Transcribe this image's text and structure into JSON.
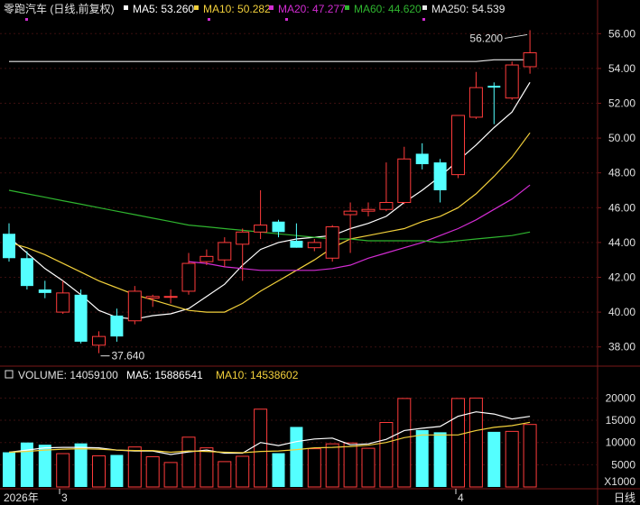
{
  "stock_name": "零跑汽车 (日线,前复权)",
  "colors": {
    "up": "#ff3b3b",
    "down": "#54ffff",
    "ma5": "#ffffff",
    "ma10": "#f2d03b",
    "ma20": "#d22cd2",
    "ma60": "#2fb52f",
    "ma250": "#e8e8e8",
    "axis_text": "#e0e0e0",
    "grid": "#3a0f0f",
    "border": "#7a1818"
  },
  "price_legend": [
    {
      "label": "MA5: 53.260",
      "color": "#ffffff"
    },
    {
      "label": "MA10: 50.282",
      "color": "#f2d03b"
    },
    {
      "label": "MA20: 47.277",
      "color": "#d22cd2"
    },
    {
      "label": "MA60: 44.620",
      "color": "#2fb52f"
    },
    {
      "label": "MA250: 54.539",
      "color": "#e8e8e8"
    }
  ],
  "volume_legend": [
    {
      "label": "VOLUME: 14059100",
      "color": "#e0e0e0"
    },
    {
      "label": "MA5: 15886541",
      "color": "#ffffff"
    },
    {
      "label": "MA10: 14538602",
      "color": "#f2d03b"
    }
  ],
  "x_labels": {
    "year": "2026年",
    "march": "3",
    "april": "4",
    "period": "日线"
  },
  "volume_unit": "X1000",
  "chart_data": [
    {
      "type": "candlestick",
      "title": "零跑汽车 (日线,前复权)",
      "y_ticks": [
        "38.00",
        "40.00",
        "42.00",
        "44.00",
        "46.00",
        "48.00",
        "50.00",
        "52.00",
        "54.00",
        "56.00"
      ],
      "ylim": [
        37.0,
        57.0
      ],
      "annotations": [
        {
          "text": "56.200",
          "candle_index": 29,
          "value": 56.2
        },
        {
          "text": "37.640",
          "candle_index": 5,
          "value": 37.64
        }
      ],
      "candles": [
        {
          "o": 44.5,
          "h": 45.1,
          "l": 42.9,
          "c": 43.1
        },
        {
          "o": 43.1,
          "h": 43.5,
          "l": 41.3,
          "c": 41.5
        },
        {
          "o": 41.3,
          "h": 41.8,
          "l": 40.8,
          "c": 41.1
        },
        {
          "o": 40.0,
          "h": 41.8,
          "l": 39.9,
          "c": 41.1
        },
        {
          "o": 41.0,
          "h": 41.3,
          "l": 38.2,
          "c": 38.3
        },
        {
          "o": 38.1,
          "h": 38.9,
          "l": 37.64,
          "c": 38.6
        },
        {
          "o": 39.8,
          "h": 40.2,
          "l": 38.3,
          "c": 38.6
        },
        {
          "o": 39.5,
          "h": 41.5,
          "l": 39.3,
          "c": 41.2
        },
        {
          "o": 40.8,
          "h": 41.0,
          "l": 40.3,
          "c": 40.9
        },
        {
          "o": 40.9,
          "h": 41.3,
          "l": 40.5,
          "c": 40.9
        },
        {
          "o": 41.2,
          "h": 43.4,
          "l": 41.0,
          "c": 42.8
        },
        {
          "o": 42.9,
          "h": 43.6,
          "l": 42.7,
          "c": 43.2
        },
        {
          "o": 43.0,
          "h": 44.3,
          "l": 42.6,
          "c": 44.0
        },
        {
          "o": 43.9,
          "h": 44.8,
          "l": 41.8,
          "c": 44.6
        },
        {
          "o": 44.6,
          "h": 47.0,
          "l": 44.2,
          "c": 45.0
        },
        {
          "o": 45.2,
          "h": 45.3,
          "l": 44.3,
          "c": 44.6
        },
        {
          "o": 44.1,
          "h": 45.1,
          "l": 43.7,
          "c": 43.7
        },
        {
          "o": 43.7,
          "h": 44.2,
          "l": 43.5,
          "c": 44.0
        },
        {
          "o": 43.1,
          "h": 45.0,
          "l": 42.9,
          "c": 44.9
        },
        {
          "o": 45.6,
          "h": 46.3,
          "l": 43.4,
          "c": 45.8
        },
        {
          "o": 45.8,
          "h": 46.3,
          "l": 45.5,
          "c": 45.9
        },
        {
          "o": 45.9,
          "h": 48.6,
          "l": 45.8,
          "c": 46.3
        },
        {
          "o": 46.3,
          "h": 49.5,
          "l": 46.2,
          "c": 48.8
        },
        {
          "o": 49.1,
          "h": 49.7,
          "l": 48.2,
          "c": 48.5
        },
        {
          "o": 48.6,
          "h": 48.8,
          "l": 46.3,
          "c": 47.0
        },
        {
          "o": 47.9,
          "h": 51.3,
          "l": 47.7,
          "c": 51.3
        },
        {
          "o": 51.2,
          "h": 53.8,
          "l": 51.1,
          "c": 52.9
        },
        {
          "o": 53.0,
          "h": 53.2,
          "l": 50.8,
          "c": 52.9
        },
        {
          "o": 52.3,
          "h": 54.4,
          "l": 52.2,
          "c": 54.2
        },
        {
          "o": 54.1,
          "h": 56.2,
          "l": 53.7,
          "c": 54.9
        }
      ],
      "ma_lines": [
        {
          "name": "MA5",
          "color": "#ffffff",
          "values": [
            44.3,
            43.4,
            42.5,
            41.8,
            41.0,
            40.1,
            39.7,
            39.6,
            39.8,
            39.9,
            40.2,
            40.9,
            41.6,
            42.7,
            43.6,
            44.0,
            44.2,
            44.3,
            44.4,
            44.8,
            45.1,
            45.5,
            46.3,
            47.0,
            47.8,
            48.7,
            49.6,
            50.6,
            51.5,
            53.2
          ]
        },
        {
          "name": "MA10",
          "color": "#f2d03b",
          "values": [
            44.0,
            43.7,
            43.3,
            42.8,
            42.3,
            41.8,
            41.4,
            41.0,
            40.7,
            40.4,
            40.1,
            40.0,
            40.0,
            40.5,
            41.2,
            41.8,
            42.4,
            43.0,
            43.7,
            44.2,
            44.4,
            44.6,
            44.8,
            45.2,
            45.5,
            46.0,
            46.8,
            47.8,
            48.9,
            50.3
          ]
        },
        {
          "name": "MA20",
          "color": "#d22cd2",
          "values": [
            null,
            null,
            null,
            null,
            null,
            null,
            null,
            null,
            null,
            null,
            42.9,
            42.8,
            42.6,
            42.5,
            42.4,
            42.4,
            42.4,
            42.4,
            42.5,
            42.7,
            43.1,
            43.4,
            43.7,
            44.0,
            44.4,
            44.8,
            45.3,
            45.9,
            46.5,
            47.3
          ]
        },
        {
          "name": "MA60",
          "color": "#2fb52f",
          "values": [
            47.0,
            46.8,
            46.6,
            46.4,
            46.2,
            46.0,
            45.8,
            45.6,
            45.4,
            45.2,
            45.0,
            44.9,
            44.8,
            44.7,
            44.6,
            44.5,
            44.4,
            44.3,
            44.2,
            44.2,
            44.1,
            44.1,
            44.1,
            44.1,
            44.0,
            44.1,
            44.2,
            44.3,
            44.4,
            44.6
          ]
        },
        {
          "name": "MA250",
          "color": "#e8e8e8",
          "values": [
            54.4,
            54.4,
            54.4,
            54.4,
            54.4,
            54.4,
            54.4,
            54.4,
            54.4,
            54.4,
            54.4,
            54.4,
            54.4,
            54.4,
            54.4,
            54.4,
            54.4,
            54.4,
            54.4,
            54.4,
            54.4,
            54.4,
            54.4,
            54.4,
            54.4,
            54.4,
            54.4,
            54.5,
            54.5,
            54.5
          ]
        }
      ]
    },
    {
      "type": "bar",
      "title": "VOLUME",
      "y_ticks": [
        "5000",
        "10000",
        "15000",
        "20000"
      ],
      "ylim": [
        0,
        21500
      ],
      "values": [
        7800,
        10000,
        9500,
        7500,
        9800,
        7000,
        7200,
        9000,
        6800,
        5500,
        11200,
        8800,
        5700,
        6900,
        17500,
        7600,
        13500,
        8600,
        9700,
        9900,
        8700,
        14500,
        19900,
        12800,
        12300,
        19900,
        20000,
        12400,
        12500,
        14059
      ],
      "ma_lines": [
        {
          "name": "MA5",
          "color": "#ffffff",
          "values": [
            7800,
            8300,
            8800,
            8900,
            8900,
            8800,
            8300,
            8100,
            8100,
            7300,
            7900,
            8300,
            7600,
            7600,
            10000,
            9300,
            10200,
            10800,
            11000,
            9500,
            9700,
            10700,
            12700,
            13200,
            13600,
            15900,
            16900,
            16400,
            15300,
            15886
          ]
        },
        {
          "name": "MA10",
          "color": "#f2d03b",
          "values": [
            7800,
            8000,
            8300,
            8500,
            8600,
            8500,
            8300,
            8200,
            8200,
            7800,
            8100,
            8000,
            7800,
            7700,
            8000,
            8100,
            8400,
            8800,
            8900,
            9100,
            9400,
            10000,
            11100,
            11700,
            11700,
            11700,
            12700,
            13400,
            13800,
            14539
          ]
        }
      ]
    }
  ]
}
